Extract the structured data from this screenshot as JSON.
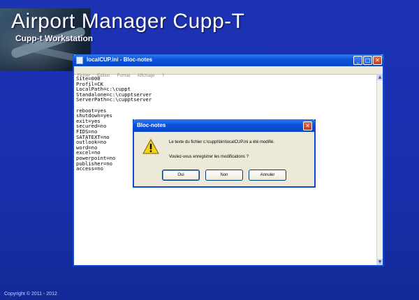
{
  "app": {
    "title": "Airport Manager Cupp-T",
    "subtitle": "Cupp-t Workstation",
    "copyright": "Copyright © 2011 - 2012"
  },
  "notepad": {
    "title": "localCUP.ini - Bloc-notes",
    "menu": [
      "Fichier",
      "Edition",
      "Format",
      "Affichage",
      "?"
    ],
    "lines": [
      "Site=000",
      "Profil=CK",
      "LocalPath=c:\\cuppt",
      "Standalone=c:\\cupptserver",
      "ServerPath=c:\\cupptserver",
      "",
      "reboot=yes",
      "shutdown=yes",
      "exit=yes",
      "secured=no",
      "FIDS=no",
      "SATATEXT=no",
      "outlook=no",
      "word=no",
      "excel=no",
      "powerpoint=no",
      "publisher=no",
      "access=no"
    ]
  },
  "dialog": {
    "title": "Bloc-notes",
    "message_line1": "Le texte du fichier c:\\cuppt\\bin\\localCUP.ini a été modifié.",
    "message_line2": "Voulez-vous enregistrer les modifications ?",
    "buttons": {
      "yes": "Oui",
      "no": "Non",
      "cancel": "Annuler"
    }
  },
  "icons": {
    "dialog_icon": "warning-icon",
    "close": "close-icon"
  },
  "colors": {
    "desktop": "#1c33b4",
    "titlebar": "#0a52db",
    "dialog_bg": "#ece9d8"
  }
}
